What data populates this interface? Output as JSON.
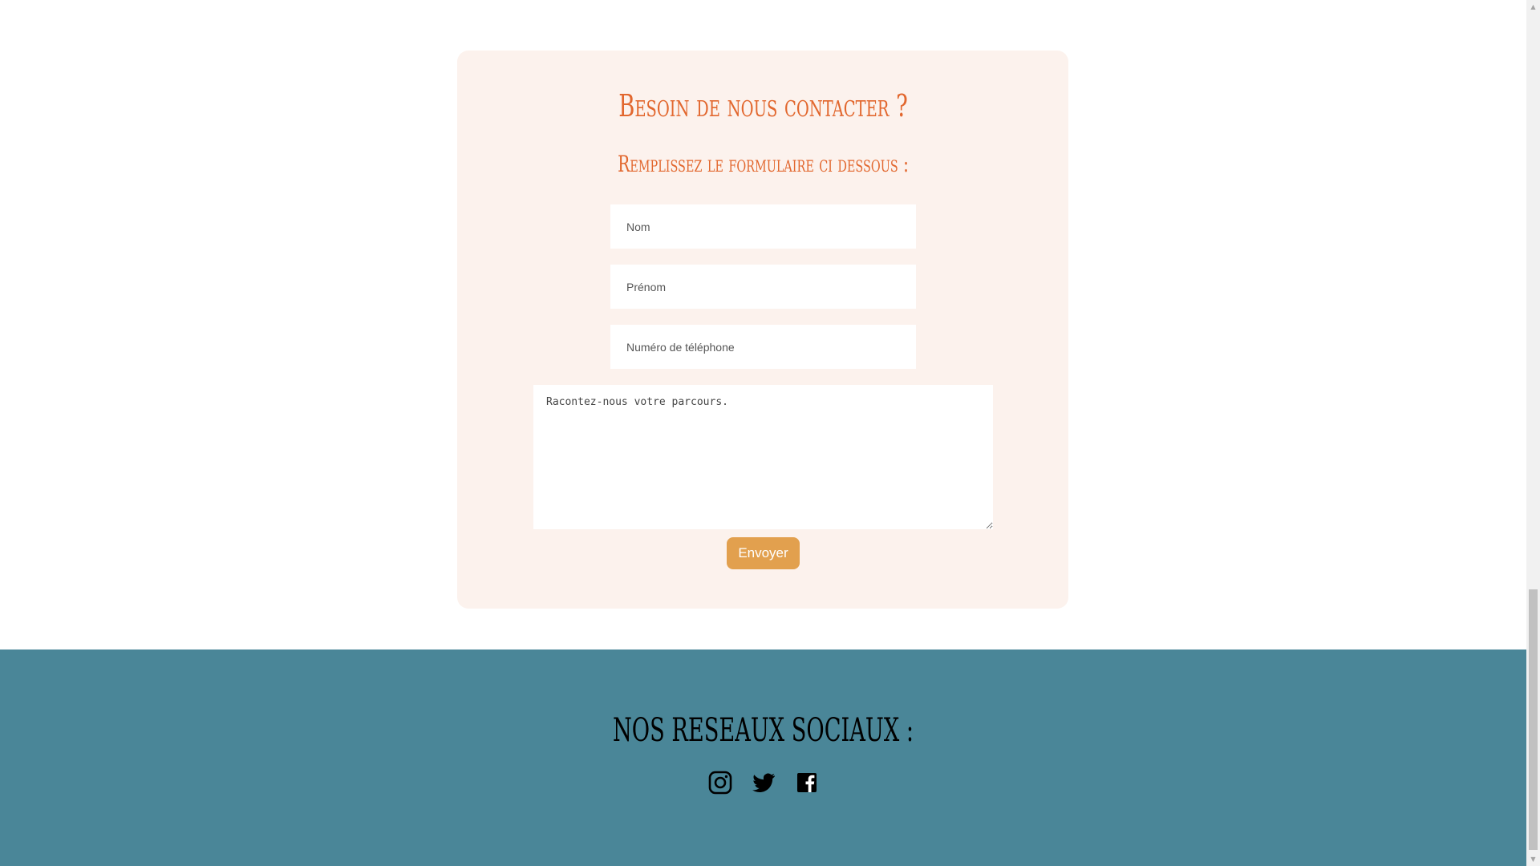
{
  "contact": {
    "title": "Besoin de nous contacter ?",
    "subtitle": "Remplissez le formulaire ci dessous :",
    "fields": {
      "nom_placeholder": "Nom",
      "prenom_placeholder": "Prénom",
      "telephone_placeholder": "Numéro de téléphone",
      "message_placeholder": "Racontez-nous votre parcours."
    },
    "submit_label": "Envoyer"
  },
  "footer": {
    "title": "NOS RESEAUX SOCIAUX :",
    "socials": [
      {
        "icon": "instagram-icon"
      },
      {
        "icon": "twitter-icon"
      },
      {
        "icon": "facebook-icon"
      }
    ]
  },
  "colors": {
    "accent_orange": "#e2672e",
    "button": "#e2a04e",
    "card_background": "#fcf2ed",
    "footer_background": "#4a8698"
  }
}
